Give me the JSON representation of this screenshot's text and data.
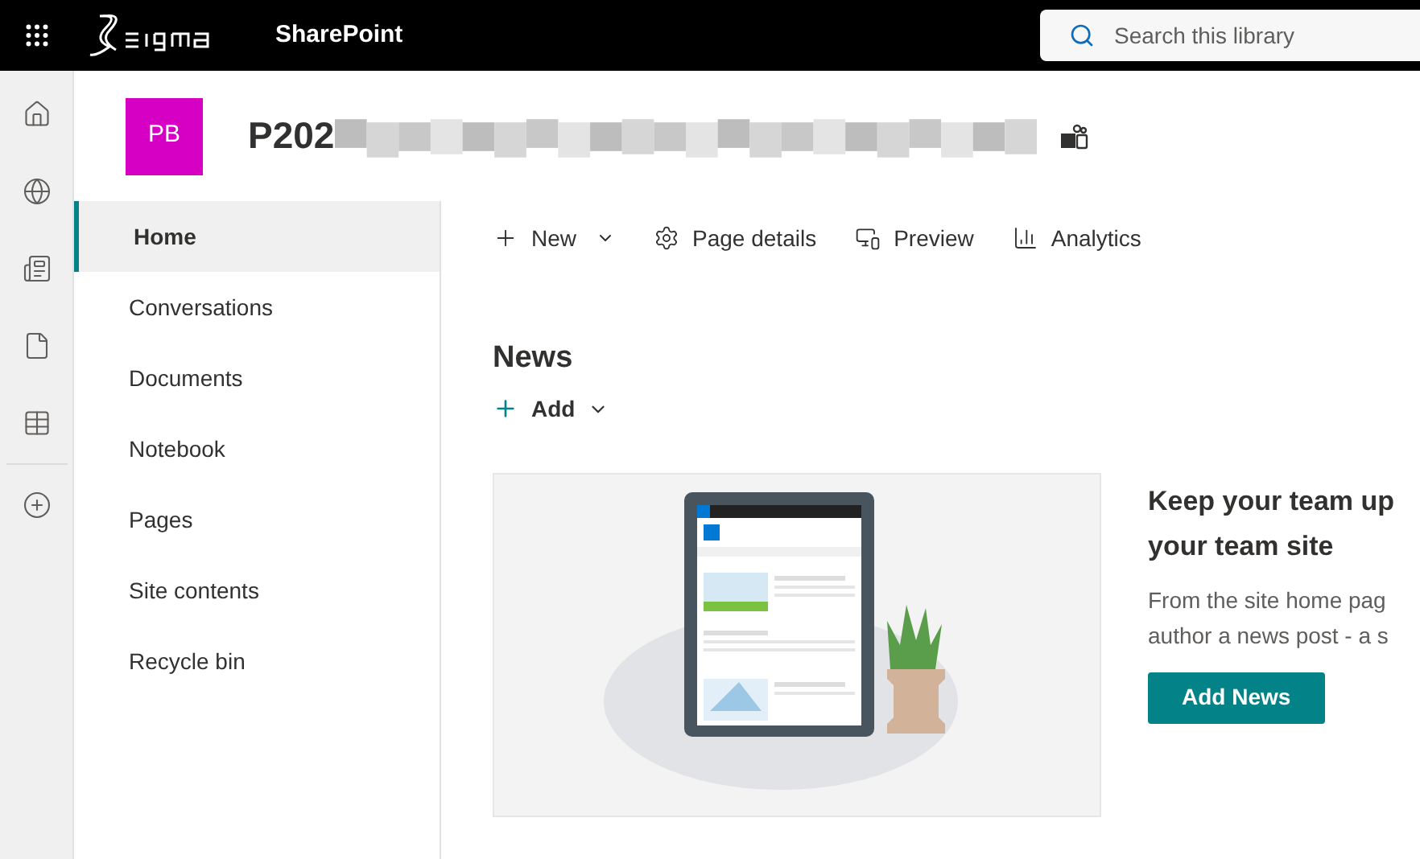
{
  "top_bar": {
    "brand": "SharePoint",
    "search": {
      "placeholder": "Search this library"
    }
  },
  "rail": [
    {
      "kind": "home",
      "selected": false
    },
    {
      "kind": "globe",
      "selected": false
    },
    {
      "kind": "news",
      "selected": false
    },
    {
      "kind": "file",
      "selected": false
    },
    {
      "kind": "list",
      "selected": false
    },
    {
      "kind": "add",
      "selected": false
    }
  ],
  "site": {
    "initials": "PB",
    "title": "P202"
  },
  "nav": [
    {
      "label": "Home",
      "selected": true
    },
    {
      "label": "Conversations",
      "selected": false
    },
    {
      "label": "Documents",
      "selected": false
    },
    {
      "label": "Notebook",
      "selected": false
    },
    {
      "label": "Pages",
      "selected": false
    },
    {
      "label": "Site contents",
      "selected": false
    },
    {
      "label": "Recycle bin",
      "selected": false
    }
  ],
  "command_bar": [
    {
      "kind": "new",
      "label": "New"
    },
    {
      "kind": "details",
      "label": "Page details"
    },
    {
      "kind": "preview",
      "label": "Preview"
    },
    {
      "kind": "analytics",
      "label": "Analytics"
    }
  ],
  "news": {
    "title": "News",
    "add": "Add",
    "heading_lines": [
      "Keep your team up",
      "your team site"
    ],
    "body_lines": [
      "From the site home pag",
      "author a news post - a s"
    ],
    "button": "Add News"
  }
}
